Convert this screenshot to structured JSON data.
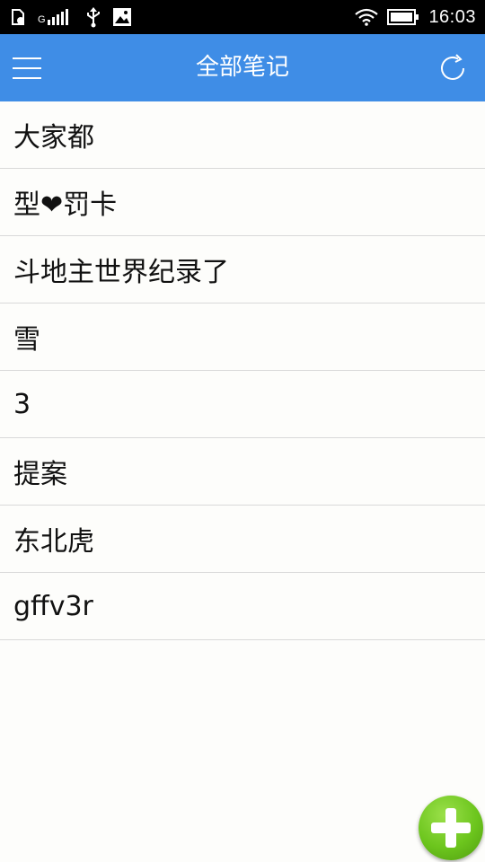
{
  "status_bar": {
    "time": "16:03",
    "signal_label": "G",
    "icons": [
      "sim-icon",
      "signal-icon",
      "usb-icon",
      "image-icon",
      "wifi-icon",
      "battery-icon"
    ]
  },
  "app_bar": {
    "title": "全部笔记",
    "menu_icon": "hamburger-menu-icon",
    "sync_icon": "refresh-icon",
    "background": "#3f8de6"
  },
  "notes": [
    {
      "title": "大家都"
    },
    {
      "title": "型❤罚卡"
    },
    {
      "title": "斗地主世界纪录了"
    },
    {
      "title": "雪"
    },
    {
      "title": "3"
    },
    {
      "title": "提案"
    },
    {
      "title": "东北虎"
    },
    {
      "title": "gffv3r"
    }
  ],
  "fab": {
    "icon": "plus-icon",
    "color": "#6cc51d"
  }
}
